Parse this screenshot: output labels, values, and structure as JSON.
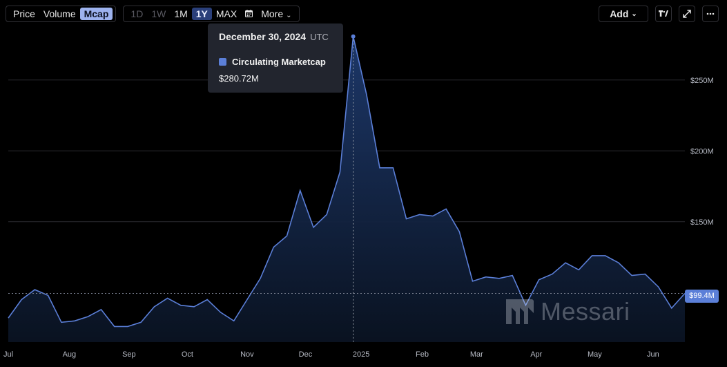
{
  "toolbar": {
    "metric_tabs": [
      {
        "label": "Price",
        "state": "normal"
      },
      {
        "label": "Volume",
        "state": "normal"
      },
      {
        "label": "Mcap",
        "state": "active"
      }
    ],
    "range_tabs": [
      {
        "label": "1D",
        "state": "dim"
      },
      {
        "label": "1W",
        "state": "dim"
      },
      {
        "label": "1M",
        "state": "normal"
      },
      {
        "label": "1Y",
        "state": "active"
      },
      {
        "label": "MAX",
        "state": "normal"
      }
    ],
    "more_label": "More",
    "add_label": "Add"
  },
  "tooltip": {
    "date": "December 30, 2024",
    "tz": "UTC",
    "series_name": "Circulating Marketcap",
    "value": "$280.72M"
  },
  "current_value_label": "$99.4M",
  "watermark_text": "Messari",
  "colors": {
    "line": "#5b7fd8",
    "area_top": "#1e3a6e",
    "area_bottom": "#0a1322",
    "grid": "#2a2a30",
    "tooltip_bg": "#22252e",
    "active_tab": "#9db2ee"
  },
  "chart_data": {
    "type": "area",
    "y_unit": "USD millions",
    "ylim": [
      65,
      285
    ],
    "y_ticks": [
      {
        "value": 150,
        "label": "$150M"
      },
      {
        "value": 200,
        "label": "$200M"
      },
      {
        "value": 250,
        "label": "$250M"
      }
    ],
    "x_ticks": [
      {
        "index": 0,
        "label": "Jul"
      },
      {
        "index": 4.6,
        "label": "Aug"
      },
      {
        "index": 9.1,
        "label": "Sep"
      },
      {
        "index": 13.5,
        "label": "Oct"
      },
      {
        "index": 18,
        "label": "Nov"
      },
      {
        "index": 22.4,
        "label": "Dec"
      },
      {
        "index": 26.6,
        "label": "2025"
      },
      {
        "index": 31.2,
        "label": "Feb"
      },
      {
        "index": 35.3,
        "label": "Mar"
      },
      {
        "index": 39.8,
        "label": "Apr"
      },
      {
        "index": 44.2,
        "label": "May"
      },
      {
        "index": 48.6,
        "label": "Jun"
      }
    ],
    "series": [
      {
        "name": "Circulating Marketcap",
        "values": [
          82,
          95,
          102,
          98,
          79,
          80,
          83,
          88,
          76,
          76,
          79,
          90,
          96,
          91,
          90,
          95,
          86,
          80,
          95,
          110,
          132,
          140,
          172,
          146,
          155,
          185,
          280.72,
          240,
          188,
          188,
          152,
          155,
          154,
          159,
          143,
          108,
          111,
          110,
          112,
          91,
          109,
          113,
          121,
          116,
          126,
          126,
          121,
          112,
          113,
          104,
          89,
          99.4
        ]
      }
    ],
    "hover_index": 26,
    "current_value": 99.4,
    "grid": true
  }
}
